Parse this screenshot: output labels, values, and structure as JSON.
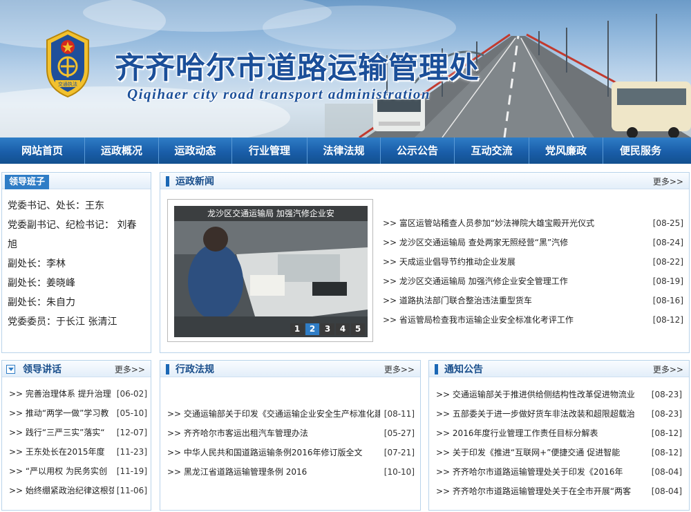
{
  "header": {
    "title": "齐齐哈尔市道路运输管理处",
    "subtitle": "Qiqihaer city road transport administration"
  },
  "nav": [
    {
      "label": "网站首页"
    },
    {
      "label": "运政概况"
    },
    {
      "label": "运政动态"
    },
    {
      "label": "行业管理"
    },
    {
      "label": "法律法规"
    },
    {
      "label": "公示公告"
    },
    {
      "label": "互动交流"
    },
    {
      "label": "党风廉政"
    },
    {
      "label": "便民服务"
    }
  ],
  "leadership": {
    "title": "领导班子",
    "members": [
      "党委书记、处长：王东",
      "党委副书记、纪检书记：    刘春旭",
      "副处长：李林",
      "副处长：姜晓峰",
      "副处长：朱自力",
      "党委委员：于长江 张清江"
    ]
  },
  "news": {
    "title": "运政新闻",
    "more": "更多>>",
    "slider": {
      "caption": "龙沙区交通运输局 加强汽修企业安",
      "pages": [
        "1",
        "2",
        "3",
        "4",
        "5"
      ],
      "active_page": "2"
    },
    "items": [
      {
        "text": ">> 富区运管站稽查人员参加“妙法禅院大雄宝殿开光仪式",
        "date": "[08-25]"
      },
      {
        "text": ">> 龙沙区交通运输局 查处两家无照经营“黑”汽修",
        "date": "[08-24]"
      },
      {
        "text": ">> 天成运业倡导节约推动企业发展",
        "date": "[08-22]"
      },
      {
        "text": ">> 龙沙区交通运输局 加强汽修企业安全管理工作",
        "date": "[08-19]"
      },
      {
        "text": ">> 道路执法部门联合整治违法重型货车",
        "date": "[08-16]"
      },
      {
        "text": ">> 省运管局检查我市运输企业安全标准化考评工作",
        "date": "[08-12]"
      }
    ]
  },
  "speeches": {
    "title": "领导讲话",
    "more": "更多>>",
    "items": [
      {
        "text": ">> 完善治理体系 提升治理",
        "date": "[06-02]"
      },
      {
        "text": ">> 推动“两学一做”学习教",
        "date": "[05-10]"
      },
      {
        "text": ">> 践行“三严三实”落实“",
        "date": "[12-07]"
      },
      {
        "text": ">> 王东处长在2015年度",
        "date": "[11-23]"
      },
      {
        "text": ">> “严以用权 为民务实创",
        "date": "[11-19]"
      },
      {
        "text": ">> 始终绷紧政治纪律这根弦",
        "date": "[11-06]"
      }
    ]
  },
  "regulations": {
    "title": "行政法规",
    "more": "更多>>",
    "items": [
      {
        "text": ">> 交通运输部关于印发《交通运输企业安全生产标准化建",
        "date": "[08-11]"
      },
      {
        "text": ">> 齐齐哈尔市客运出租汽车管理办法",
        "date": "[05-27]"
      },
      {
        "text": ">> 中华人民共和国道路运输条例2016年修订版全文",
        "date": "[07-21]"
      },
      {
        "text": ">> 黑龙江省道路运输管理条例 2016",
        "date": "[10-10]"
      }
    ]
  },
  "notices": {
    "title": "通知公告",
    "more": "更多>>",
    "items": [
      {
        "text": ">> 交通运输部关于推进供给侧结构性改革促进物流业",
        "date": "[08-23]"
      },
      {
        "text": ">> 五部委关于进一步做好货车非法改装和超限超载治",
        "date": "[08-23]"
      },
      {
        "text": ">> 2016年度行业管理工作责任目标分解表",
        "date": "[08-12]"
      },
      {
        "text": ">> 关于印发《推进“互联网+”便捷交通 促进智能",
        "date": "[08-12]"
      },
      {
        "text": ">> 齐齐哈尔市道路运输管理处关于印发《2016年",
        "date": "[08-04]"
      },
      {
        "text": ">> 齐齐哈尔市道路运输管理处关于在全市开展“两客",
        "date": "[08-04]"
      }
    ]
  },
  "emblem": {
    "text": "交通执法"
  }
}
